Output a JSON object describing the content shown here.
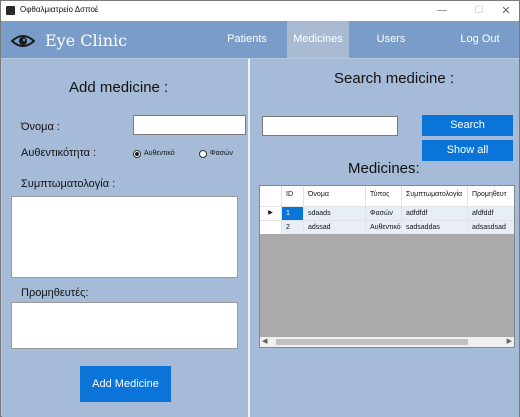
{
  "window": {
    "title": "Οφθαλμιατρείο Δσποέ",
    "minimize": "—",
    "maximize": "☐",
    "close": "✕"
  },
  "navbar": {
    "brand": "Eye Clinic",
    "brand_icon": "eye-icon",
    "items": [
      {
        "label": "Patients",
        "active": false
      },
      {
        "label": "Medicines",
        "active": true
      },
      {
        "label": "Users",
        "active": false
      },
      {
        "label": "Log Out",
        "active": false
      }
    ],
    "colors": {
      "bar": "#7a9cc9",
      "active": "#a8bbd3"
    }
  },
  "add_panel": {
    "heading": "Add medicine :",
    "name_label": "Όνομα :",
    "name_value": "",
    "auth_label": "Αυθεντικότητα :",
    "auth_options": [
      {
        "label": "Αυθεντικό",
        "checked": true
      },
      {
        "label": "Φασών",
        "checked": false
      }
    ],
    "symptoms_label": "Συμπτωματολογία :",
    "symptoms_value": "",
    "suppliers_label": "Προμηθευτές:",
    "suppliers_value": "",
    "add_button": "Add Medicine"
  },
  "search_panel": {
    "heading": "Search medicine :",
    "search_value": "",
    "search_button": "Search",
    "show_all_button": "Show all",
    "list_heading": "Medicines:"
  },
  "table": {
    "columns": [
      "ID",
      "Όνομα",
      "Τύπος",
      "Συμπτωματολογία",
      "Προμηθευτ"
    ],
    "rows": [
      {
        "selected": true,
        "cells": [
          "1",
          "sdaads",
          "Φασών",
          "adfdfdf",
          "afdfddf"
        ]
      },
      {
        "selected": false,
        "cells": [
          "2",
          "adssad",
          "Αυθεντικό",
          "sadsaddas",
          "adsasdsad"
        ]
      }
    ],
    "current_row_marker": "▶",
    "scroll_left": "◀",
    "scroll_right": "▶"
  },
  "colors": {
    "accent": "#0a74d8",
    "panel": "#a5bbd7"
  }
}
